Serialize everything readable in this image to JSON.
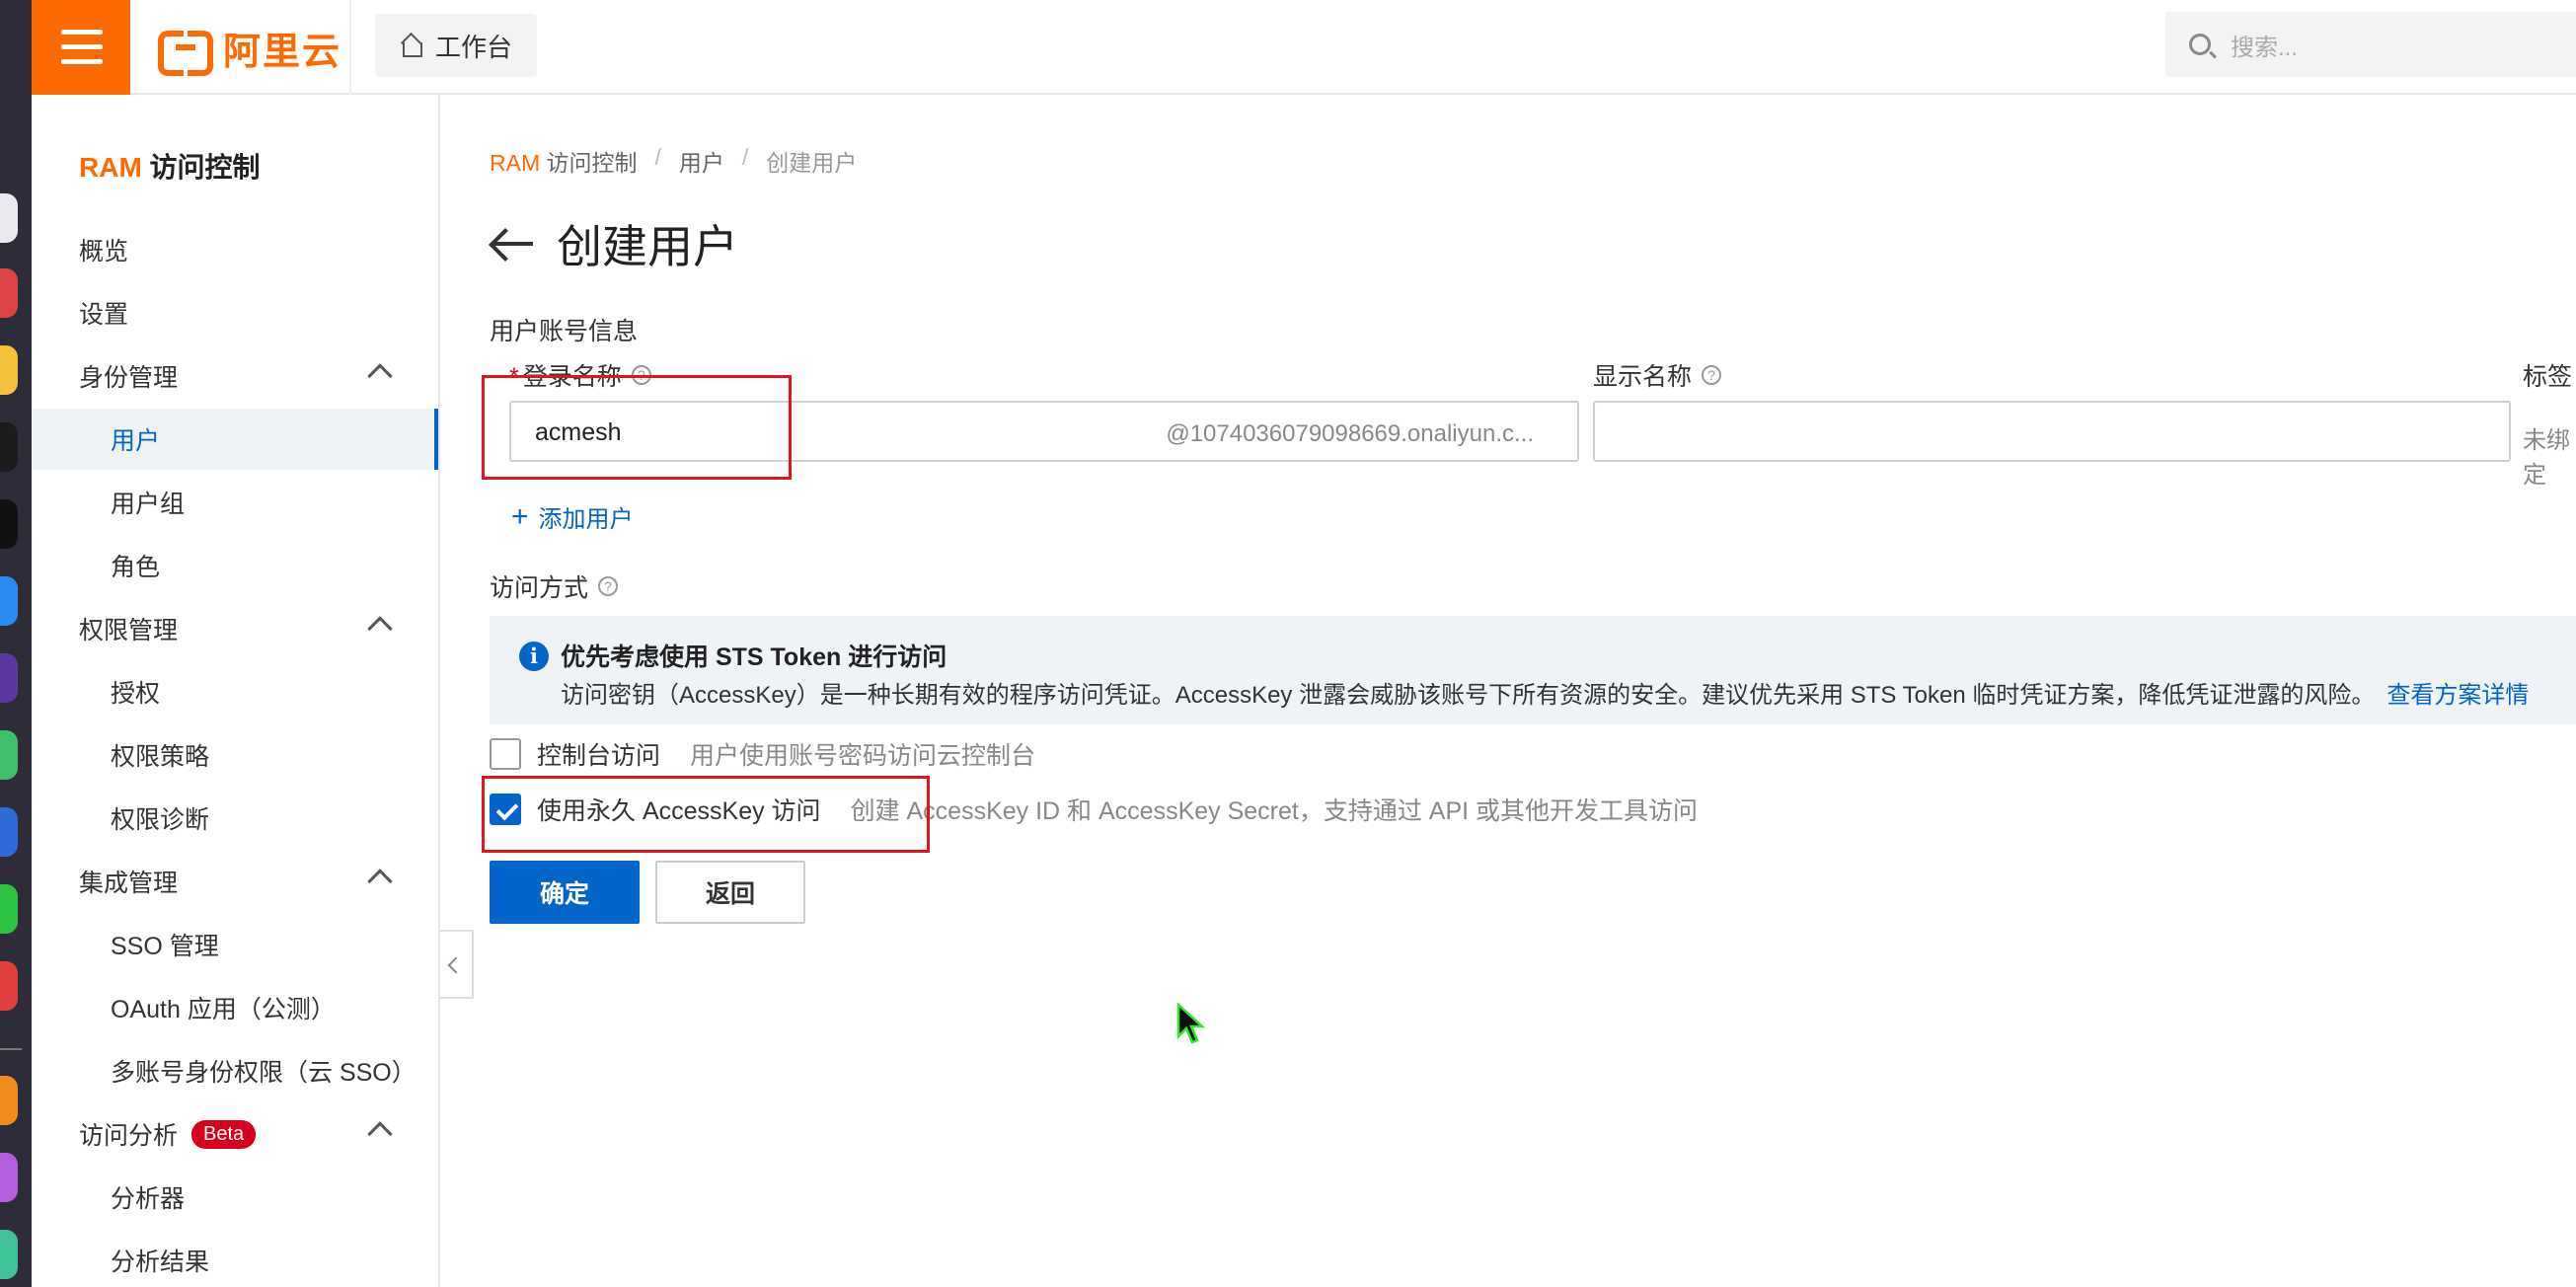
{
  "topbar": {
    "logo_text": "阿里云",
    "workbench_label": "工作台",
    "search_placeholder": "搜索..."
  },
  "sidebar": {
    "title_prefix": "RAM",
    "title_suffix": " 访问控制",
    "items": [
      {
        "label": "概览"
      },
      {
        "label": "设置"
      },
      {
        "label": "身份管理"
      },
      {
        "label": "用户"
      },
      {
        "label": "用户组"
      },
      {
        "label": "角色"
      },
      {
        "label": "权限管理"
      },
      {
        "label": "授权"
      },
      {
        "label": "权限策略"
      },
      {
        "label": "权限诊断"
      },
      {
        "label": "集成管理"
      },
      {
        "label": "SSO 管理"
      },
      {
        "label": "OAuth 应用（公测）"
      },
      {
        "label": "多账号身份权限（云 SSO）"
      },
      {
        "label": "访问分析"
      },
      {
        "label": "分析器"
      },
      {
        "label": "分析结果"
      }
    ],
    "beta_badge": "Beta"
  },
  "breadcrumb": {
    "ram": "RAM",
    "root_suffix": " 访问控制",
    "sep": "/",
    "users": "用户",
    "current": "创建用户"
  },
  "page": {
    "title": "创建用户",
    "section_account": "用户账号信息",
    "login_name_label": "登录名称",
    "login_name_required": "*",
    "login_name_value": "acmesh",
    "login_name_suffix": "@1074036079098669.onaliyun.c...",
    "display_name_label": "显示名称",
    "display_name_value": "",
    "tag_label": "标签",
    "tag_value": "未绑定",
    "add_user_label": "添加用户",
    "section_access": "访问方式",
    "help_glyph": "?"
  },
  "info": {
    "title": "优先考虑使用 STS Token 进行访问",
    "body": "访问密钥（AccessKey）是一种长期有效的程序访问凭证。AccessKey 泄露会威胁该账号下所有资源的安全。建议优先采用 STS Token 临时凭证方案，降低凭证泄露的风险。",
    "link": "查看方案详情",
    "icon_glyph": "i"
  },
  "access_options": [
    {
      "label": "控制台访问",
      "desc": "用户使用账号密码访问云控制台",
      "checked": false
    },
    {
      "label": "使用永久 AccessKey 访问",
      "desc": "创建 AccessKey ID 和 AccessKey Secret，支持通过 API 或其他开发工具访问",
      "checked": true
    }
  ],
  "buttons": {
    "confirm": "确定",
    "back": "返回"
  },
  "colors": {
    "brand": "#ff6a00",
    "primary": "#0064c8",
    "highlight": "#e0161e",
    "danger": "#d9001b"
  }
}
